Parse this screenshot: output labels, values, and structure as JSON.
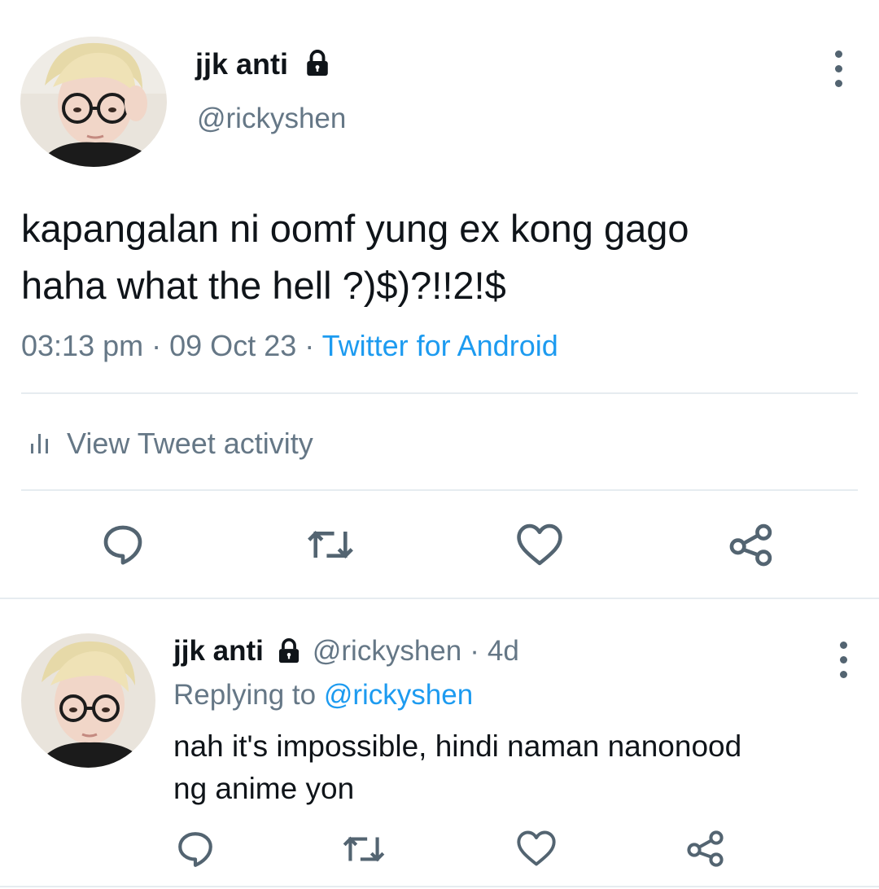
{
  "tweet": {
    "author_name": "jjk anti",
    "handle": "@rickyshen",
    "text_line1": "kapangalan ni oomf yung ex kong gago",
    "text_line2": "haha what the hell ?)$)?!!2!$",
    "time": "03:13 pm",
    "sep1": "·",
    "date": "09 Oct 23",
    "sep2": "·",
    "source": "Twitter for Android",
    "activity_label": "View Tweet activity"
  },
  "reply": {
    "author_name": "jjk anti",
    "handle": "@rickyshen",
    "dot": "·",
    "age": "4d",
    "replying_prefix": "Replying to",
    "replying_to": "@rickyshen",
    "text_line1": "nah it's impossible, hindi naman nanonood",
    "text_line2": "ng anime yon"
  },
  "icons": {
    "lock": "lock-icon",
    "more": "more-vertical-icon",
    "activity": "bar-chart-icon",
    "reply": "reply-icon",
    "retweet": "retweet-icon",
    "like": "heart-icon",
    "share": "share-icon"
  },
  "colors": {
    "link": "#1d9bf0",
    "muted": "#657786",
    "text": "#0f1419",
    "divider": "#e6ecf0"
  }
}
